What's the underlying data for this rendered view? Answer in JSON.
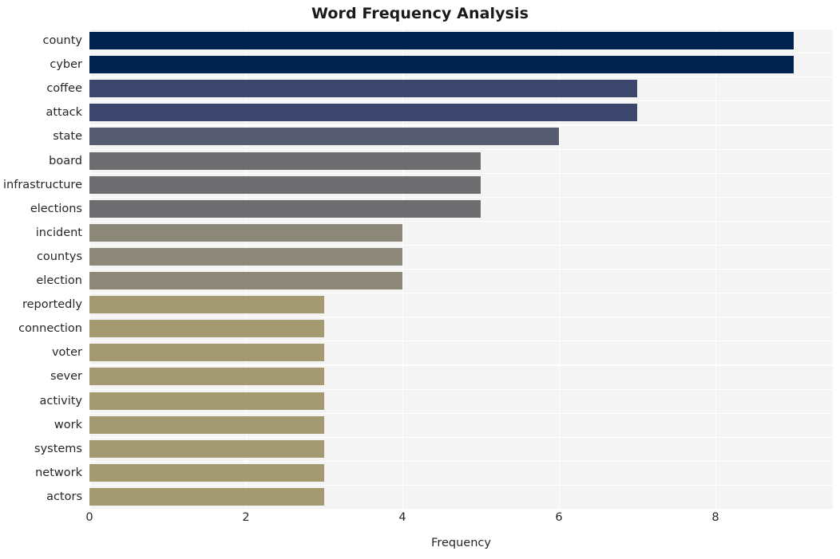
{
  "chart_data": {
    "type": "bar",
    "orientation": "horizontal",
    "title": "Word Frequency Analysis",
    "xlabel": "Frequency",
    "ylabel": "",
    "categories": [
      "county",
      "cyber",
      "coffee",
      "attack",
      "state",
      "board",
      "infrastructure",
      "elections",
      "incident",
      "countys",
      "election",
      "reportedly",
      "connection",
      "voter",
      "sever",
      "activity",
      "work",
      "systems",
      "network",
      "actors"
    ],
    "values": [
      9,
      9,
      7,
      7,
      6,
      5,
      5,
      5,
      4,
      4,
      4,
      3,
      3,
      3,
      3,
      3,
      3,
      3,
      3,
      3
    ],
    "xticks": [
      "0",
      "2",
      "4",
      "6",
      "8"
    ],
    "xtick_values": [
      0,
      2,
      4,
      6,
      8
    ],
    "xlim": [
      0,
      9.5
    ],
    "grid": true,
    "legend": "none",
    "colormap": "cividis",
    "bar_colors": [
      "#00224e",
      "#00224e",
      "#3c456b",
      "#3c456b",
      "#575c70",
      "#6e6e71",
      "#6e6e71",
      "#6e6e71",
      "#8b8779",
      "#8b8779",
      "#8b8779",
      "#a39a72",
      "#a39a72",
      "#a39a72",
      "#a39a72",
      "#a39a72",
      "#a39a72",
      "#a39a72",
      "#a39a72",
      "#a49a71"
    ],
    "plot_background": "#f4f4f5",
    "grid_color": "#ffffff",
    "figure_background": "#ffffff",
    "text_color": "#262626"
  }
}
